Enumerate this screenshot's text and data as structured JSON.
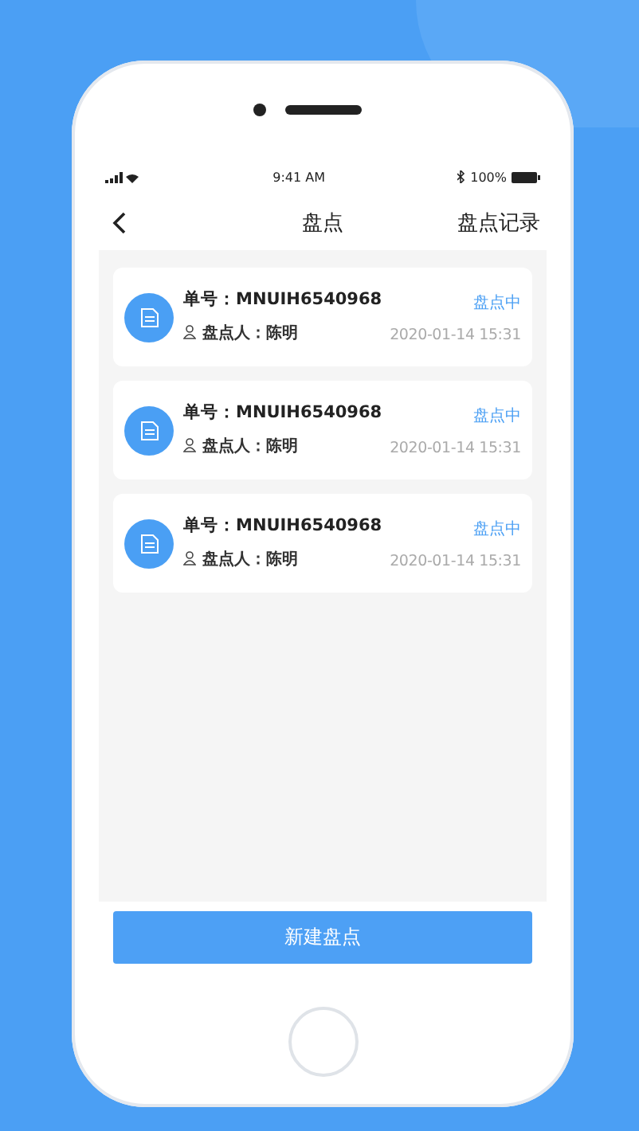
{
  "status_bar": {
    "time": "9:41 AM",
    "battery": "100%"
  },
  "nav": {
    "title": "盘点",
    "action": "盘点记录"
  },
  "records": [
    {
      "number": "单号：MNUIH6540968",
      "person": "盘点人：陈明",
      "status": "盘点中",
      "time": "2020-01-14 15:31"
    },
    {
      "number": "单号：MNUIH6540968",
      "person": "盘点人：陈明",
      "status": "盘点中",
      "time": "2020-01-14 15:31"
    },
    {
      "number": "单号：MNUIH6540968",
      "person": "盘点人：陈明",
      "status": "盘点中",
      "time": "2020-01-14 15:31"
    }
  ],
  "button": "新建盘点"
}
